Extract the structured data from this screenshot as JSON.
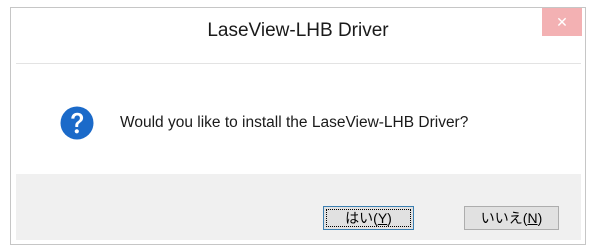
{
  "window": {
    "title": "LaseView-LHB Driver",
    "close_glyph": "✕"
  },
  "message": {
    "icon": "question-icon",
    "text": "Would you like to install the LaseView-LHB Driver?"
  },
  "buttons": {
    "yes": {
      "prefix": "はい(",
      "mnemonic": "Y",
      "suffix": ")"
    },
    "no": {
      "prefix": "いいえ(",
      "mnemonic": "N",
      "suffix": ")"
    }
  },
  "colors": {
    "icon_blue": "#1b6ac9",
    "close_bg": "#f3b1b3",
    "footer_bg": "#f0f0f0"
  }
}
